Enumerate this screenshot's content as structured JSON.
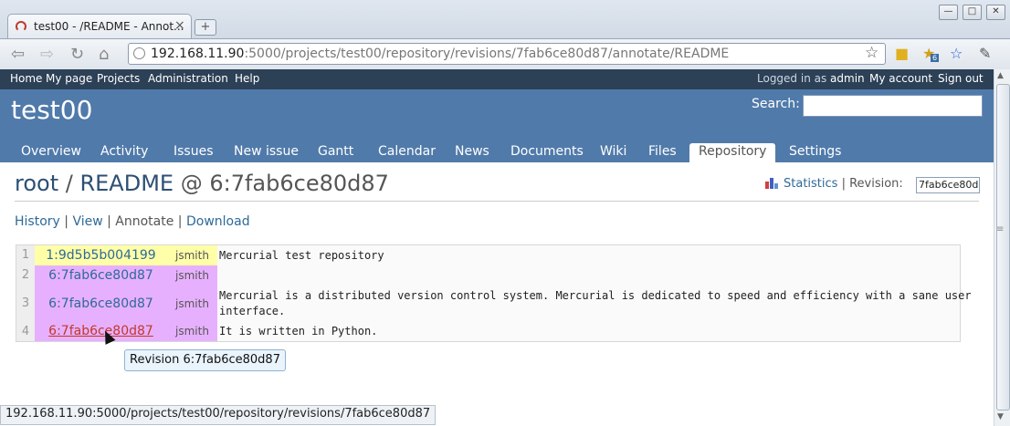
{
  "browser": {
    "tab_title": "test00 - /README - Annot...",
    "tab_close": "×",
    "newtab": "+",
    "window_buttons": [
      "—",
      "□",
      "✕"
    ],
    "url_host": "192.168.11.90",
    "url_rest": ":5000/projects/test00/repository/revisions/7fab6ce80d87/annotate/README",
    "extension_badge": "6"
  },
  "top_menu": {
    "items": [
      "Home",
      "My page",
      "Projects",
      "Administration",
      "Help"
    ],
    "logged_in_prefix": "Logged in as ",
    "user": "admin",
    "my_account": "My account",
    "sign_out": "Sign out"
  },
  "header": {
    "project_title": "test00",
    "search_label": "Search:"
  },
  "main_menu": {
    "tabs": [
      "Overview",
      "Activity",
      "Issues",
      "New issue",
      "Gantt",
      "Calendar",
      "News",
      "Documents",
      "Wiki",
      "Files",
      "Repository",
      "Settings"
    ],
    "active": "Repository"
  },
  "content": {
    "heading_root": "root",
    "heading_sep": " / ",
    "heading_file": "README",
    "heading_rev": " @ 6:7fab6ce80d87",
    "statistics": "Statistics",
    "revision_label": "Revision:",
    "revision_value": "7fab6ce80d",
    "links": {
      "history": "History",
      "view": "View",
      "annotate": "Annotate",
      "download": "Download",
      "sep": " | "
    }
  },
  "annotate": {
    "rows": [
      {
        "line": "1",
        "revision": "1:9d5b5b004199",
        "author": "jsmith",
        "code": "Mercurial test repository"
      },
      {
        "line": "2",
        "revision": "6:7fab6ce80d87",
        "author": "jsmith",
        "code": ""
      },
      {
        "line": "3",
        "revision": "6:7fab6ce80d87",
        "author": "jsmith",
        "code": "Mercurial is a distributed version control system. Mercurial is dedicated to speed and efficiency with a sane user\ninterface."
      },
      {
        "line": "4",
        "revision": "6:7fab6ce80d87",
        "author": "jsmith",
        "code": "It is written in Python."
      }
    ]
  },
  "tooltip": "Revision 6:7fab6ce80d87",
  "status_bar": "192.168.11.90:5000/projects/test00/repository/revisions/7fab6ce80d87",
  "colors": {
    "top_menu": "#2c4056",
    "header": "#507aaa",
    "old_revision": "#ffffa8",
    "new_revision": "#e7b0ff",
    "link": "#2d6a99"
  }
}
